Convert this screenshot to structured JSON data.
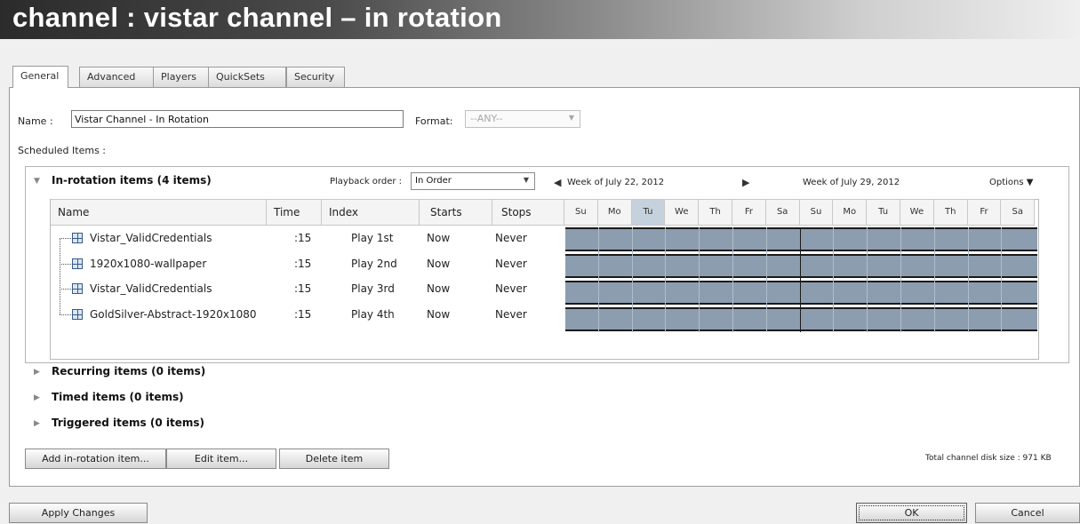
{
  "window": {
    "title": "channel : vistar channel – in rotation"
  },
  "tabs": [
    "General",
    "Advanced",
    "Players",
    "QuickSets",
    "Security"
  ],
  "form": {
    "name_label": "Name :",
    "name_value": "Vistar Channel - In Rotation",
    "format_label": "Format:",
    "format_value": "--ANY--",
    "scheduled_label": "Scheduled Items :"
  },
  "rotation": {
    "header": "In-rotation items (4 items)",
    "playback_label": "Playback order :",
    "playback_value": "In Order",
    "week1": "Week of July 22, 2012",
    "week2": "Week of July 29, 2012",
    "options_label": "Options",
    "columns": [
      "Name",
      "Time",
      "Index",
      "Starts",
      "Stops"
    ],
    "days": [
      "Su",
      "Mo",
      "Tu",
      "We",
      "Th",
      "Fr",
      "Sa",
      "Su",
      "Mo",
      "Tu",
      "We",
      "Th",
      "Fr",
      "Sa"
    ],
    "highlight_day_index": 2,
    "rows": [
      {
        "name": "Vistar_ValidCredentials",
        "time": ":15",
        "index": "Play 1st",
        "starts": "Now",
        "stops": "Never"
      },
      {
        "name": "1920x1080-wallpaper",
        "time": ":15",
        "index": "Play 2nd",
        "starts": "Now",
        "stops": "Never"
      },
      {
        "name": "Vistar_ValidCredentials",
        "time": ":15",
        "index": "Play 3rd",
        "starts": "Now",
        "stops": "Never"
      },
      {
        "name": "GoldSilver-Abstract-1920x1080",
        "time": ":15",
        "index": "Play 4th",
        "starts": "Now",
        "stops": "Never"
      }
    ]
  },
  "sections": {
    "recurring": "Recurring items (0 items)",
    "timed": "Timed items (0 items)",
    "triggered": "Triggered items (0 items)"
  },
  "actions": {
    "add": "Add in-rotation item...",
    "edit": "Edit item...",
    "delete": "Delete item",
    "disk_size": "Total channel disk size : 971 KB"
  },
  "footer": {
    "apply": "Apply Changes",
    "ok": "OK",
    "cancel": "Cancel"
  },
  "colors": {
    "bar": "#8c9db0",
    "today": "#c5d1dc"
  },
  "icons": {
    "collapse": "triangle-down-icon",
    "expand": "triangle-right-icon",
    "prev_week": "arrow-left-icon",
    "next_week": "arrow-right-icon",
    "options": "caret-down-icon",
    "item": "content-item-icon"
  }
}
